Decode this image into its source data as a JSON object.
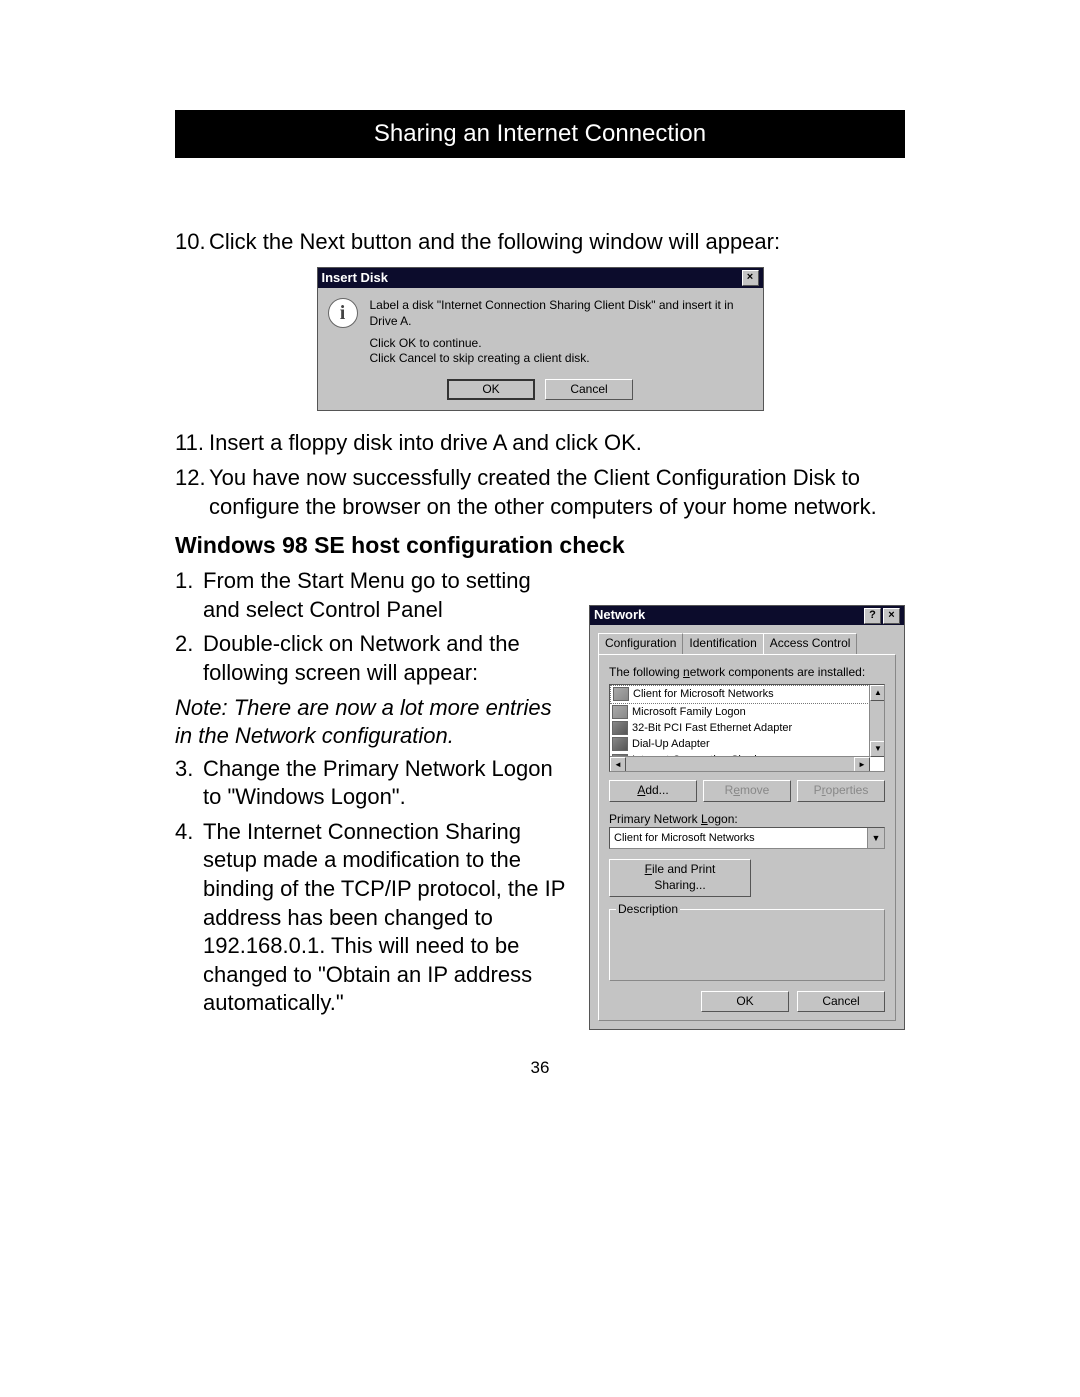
{
  "header": "Sharing an Internet Connection",
  "step10": {
    "num": "10.",
    "text": "Click the Next button and the following window will appear:"
  },
  "insert_disk": {
    "title": "Insert Disk",
    "line1": "Label a disk \"Internet Connection Sharing Client Disk\" and insert it in Drive A.",
    "line2": "Click OK to continue.",
    "line3": "Click Cancel to skip creating a client disk.",
    "ok": "OK",
    "cancel": "Cancel"
  },
  "step11": {
    "num": "11.",
    "text": "Insert a floppy disk into drive A and click OK."
  },
  "step12": {
    "num": "12.",
    "text": "You have now successfully created the Client Configuration Disk to configure the browser on the other computers of your home network."
  },
  "heading2": "Windows 98 SE host configuration check",
  "ss1": {
    "num": "1.",
    "text": "From the Start Menu go to setting and select Control Panel"
  },
  "ss2": {
    "num": "2.",
    "text": "Double-click on Network and the following screen will appear:"
  },
  "note": "Note: There are now a lot more entries in the Network configuration.",
  "ss3": {
    "num": "3.",
    "text": "Change the Primary Network Logon to \"Windows Logon\"."
  },
  "ss4": {
    "num": "4.",
    "text": "The Internet Connection Sharing setup made a modification to the binding of the TCP/IP protocol, the IP address has been changed to 192.168.0.1. This will need to be changed to \"Obtain an IP address automatically.\""
  },
  "network": {
    "title": "Network",
    "tabs": {
      "config": "Configuration",
      "ident": "Identification",
      "access": "Access Control"
    },
    "list_label": "The following network components are installed:",
    "items": [
      "Client for Microsoft Networks",
      "Microsoft Family Logon",
      "32-Bit PCI Fast Ethernet Adapter",
      "Dial-Up Adapter",
      "Internet Connection Sharing"
    ],
    "add": "Add...",
    "remove": "Remove",
    "properties": "Properties",
    "primary_label": "Primary Network Logon:",
    "primary_value": "Client for Microsoft Networks",
    "fps": "File and Print Sharing...",
    "desc": "Description",
    "ok": "OK",
    "cancel": "Cancel"
  },
  "page_number": "36"
}
